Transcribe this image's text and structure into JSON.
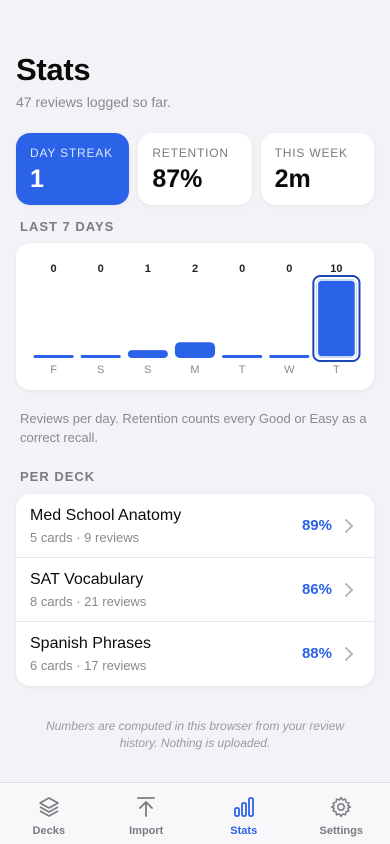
{
  "header": {
    "title": "Stats",
    "subtitle": "47 reviews logged so far."
  },
  "stats": [
    {
      "label": "DAY STREAK",
      "value": "1"
    },
    {
      "label": "RETENTION",
      "value": "87%"
    },
    {
      "label": "THIS WEEK",
      "value": "2m"
    }
  ],
  "last7": {
    "section_label": "LAST 7 DAYS",
    "note": "Reviews per day. Retention counts every Good or Easy as a correct recall."
  },
  "chart_data": {
    "type": "bar",
    "categories": [
      "F",
      "S",
      "S",
      "M",
      "T",
      "W",
      "T"
    ],
    "values": [
      0,
      0,
      1,
      2,
      0,
      0,
      10
    ],
    "highlight_index": 6,
    "ylim": [
      0,
      10
    ],
    "bar_color": "#2b63e8"
  },
  "per_deck": {
    "section_label": "PER DECK",
    "decks": [
      {
        "name": "Med School Anatomy",
        "meta": "5 cards · 9 reviews",
        "pct": "89%"
      },
      {
        "name": "SAT Vocabulary",
        "meta": "8 cards · 21 reviews",
        "pct": "86%"
      },
      {
        "name": "Spanish Phrases",
        "meta": "6 cards · 17 reviews",
        "pct": "88%"
      }
    ]
  },
  "footnote": "Numbers are computed in this browser from your review history. Nothing is uploaded.",
  "tabs": [
    {
      "label": "Decks",
      "icon": "layers-icon",
      "active": false
    },
    {
      "label": "Import",
      "icon": "upload-icon",
      "active": false
    },
    {
      "label": "Stats",
      "icon": "bar-chart-icon",
      "active": true
    },
    {
      "label": "Settings",
      "icon": "gear-icon",
      "active": false
    }
  ],
  "colors": {
    "accent": "#2b63e8",
    "background": "#f2f2f7",
    "secondary_text": "#8a8a8e"
  }
}
